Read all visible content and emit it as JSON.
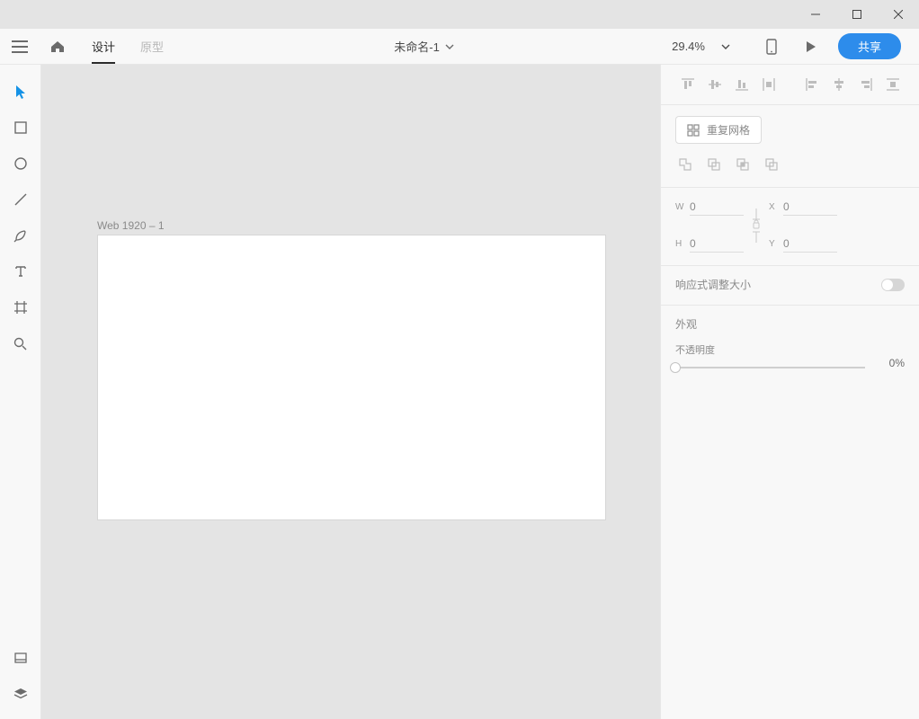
{
  "window": {
    "minimize": "–",
    "maximize": "☐",
    "close": "✕"
  },
  "header": {
    "tabs": {
      "design": "设计",
      "prototype": "原型"
    },
    "doc_name": "未命名-1",
    "zoom": "29.4%",
    "share": "共享"
  },
  "left_toolbar": {
    "select": "select",
    "rect": "rectangle",
    "ellipse": "ellipse",
    "line": "line",
    "pen": "pen",
    "text": "text",
    "artboard": "artboard",
    "zoom": "zoom",
    "assets": "assets",
    "layers": "layers"
  },
  "canvas": {
    "artboard_name": "Web 1920 – 1"
  },
  "right_panel": {
    "repeat_grid": "重复网格",
    "dims": {
      "w_label": "W",
      "w": "0",
      "h_label": "H",
      "h": "0",
      "x_label": "X",
      "x": "0",
      "y_label": "Y",
      "y": "0"
    },
    "responsive_resize": "响应式调整大小",
    "appearance": "外观",
    "opacity_label": "不透明度",
    "opacity_value": "0%"
  }
}
